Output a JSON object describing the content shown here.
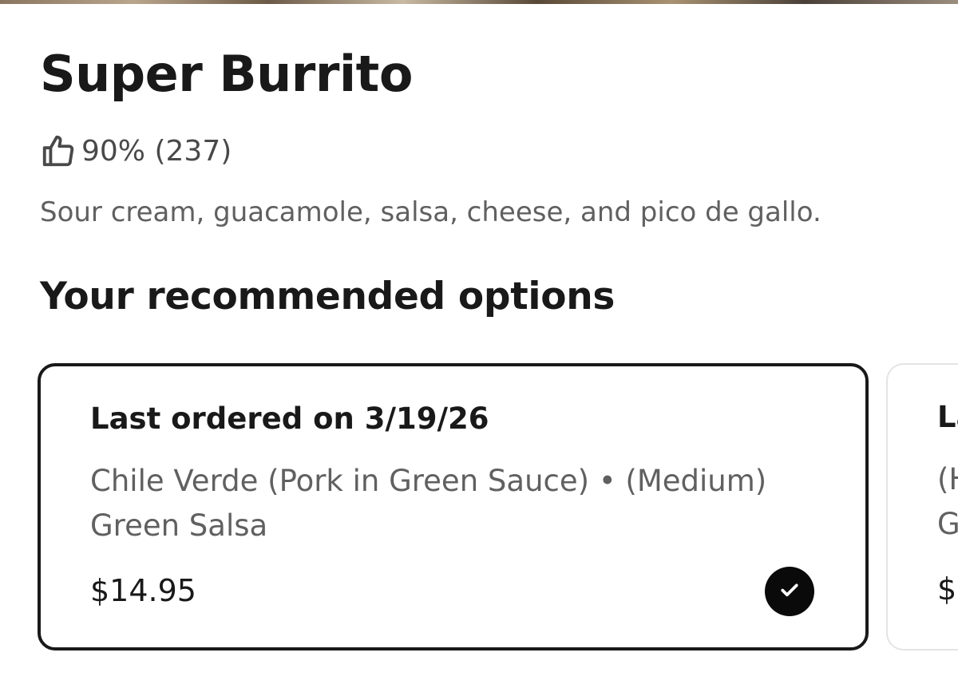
{
  "item": {
    "title": "Super Burrito",
    "rating": "90% (237)",
    "description": "Sour cream, guacamole, salsa, cheese, and pico de gallo."
  },
  "recommended": {
    "heading": "Your recommended options",
    "options": [
      {
        "date_label": "Last ordered on 3/19/26",
        "details_line1": "Chile Verde (Pork in Green Sauce) • (Medium)",
        "details_line2": "Green Salsa",
        "price": "$14.95",
        "selected": true
      },
      {
        "date_label": "La",
        "details_line1": "(H",
        "details_line2": "G",
        "price": "$1",
        "selected": false
      }
    ]
  },
  "icons": {
    "rating": "thumbs-up-icon",
    "selected": "checkmark-icon"
  },
  "colors": {
    "text_primary": "#191919",
    "text_secondary": "#606060",
    "selected_border": "#191919",
    "unselected_border": "#e4e4e4",
    "check_badge": "#0a0a0a"
  }
}
